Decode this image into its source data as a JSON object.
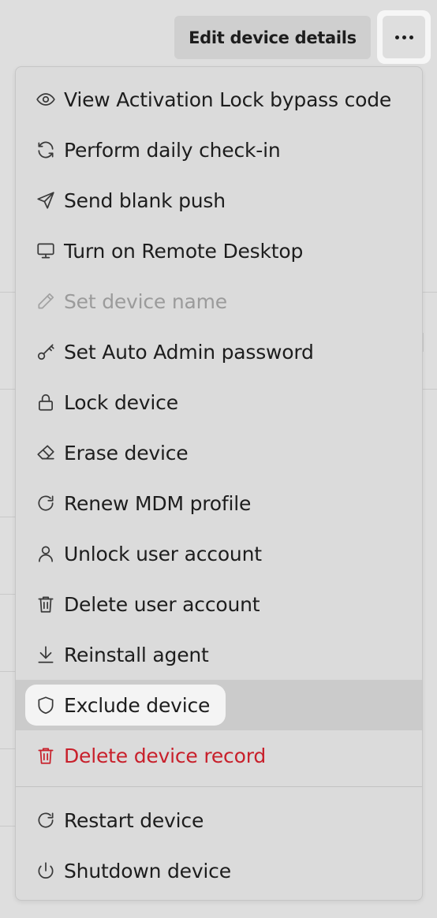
{
  "header": {
    "edit_label": "Edit device details",
    "more_icon": "ellipsis-icon"
  },
  "colors": {
    "background": "#dedede",
    "menu_bg": "#dbdbdb",
    "highlight": "#cbcbcb",
    "danger": "#c8202b",
    "disabled": "#9b9b9b"
  },
  "menu": {
    "items": [
      {
        "label": "View Activation Lock bypass code",
        "icon": "eye-icon"
      },
      {
        "label": "Perform daily check-in",
        "icon": "refresh-icon"
      },
      {
        "label": "Send blank push",
        "icon": "send-icon"
      },
      {
        "label": "Turn on Remote Desktop",
        "icon": "monitor-icon"
      },
      {
        "label": "Set device name",
        "icon": "pencil-icon",
        "state": "disabled"
      },
      {
        "label": "Set Auto Admin password",
        "icon": "key-icon"
      },
      {
        "label": "Lock device",
        "icon": "lock-icon"
      },
      {
        "label": "Erase device",
        "icon": "eraser-icon"
      },
      {
        "label": "Renew MDM profile",
        "icon": "rotate-icon"
      },
      {
        "label": "Unlock user account",
        "icon": "user-icon"
      },
      {
        "label": "Delete user account",
        "icon": "trash-icon"
      },
      {
        "label": "Reinstall agent",
        "icon": "download-icon"
      },
      {
        "label": "Exclude device",
        "icon": "shield-icon",
        "state": "highlighted"
      },
      {
        "label": "Delete device record",
        "icon": "trash-icon",
        "state": "danger"
      }
    ],
    "secondary_items": [
      {
        "label": "Restart device",
        "icon": "rotate-icon"
      },
      {
        "label": "Shutdown device",
        "icon": "power-icon"
      }
    ]
  }
}
